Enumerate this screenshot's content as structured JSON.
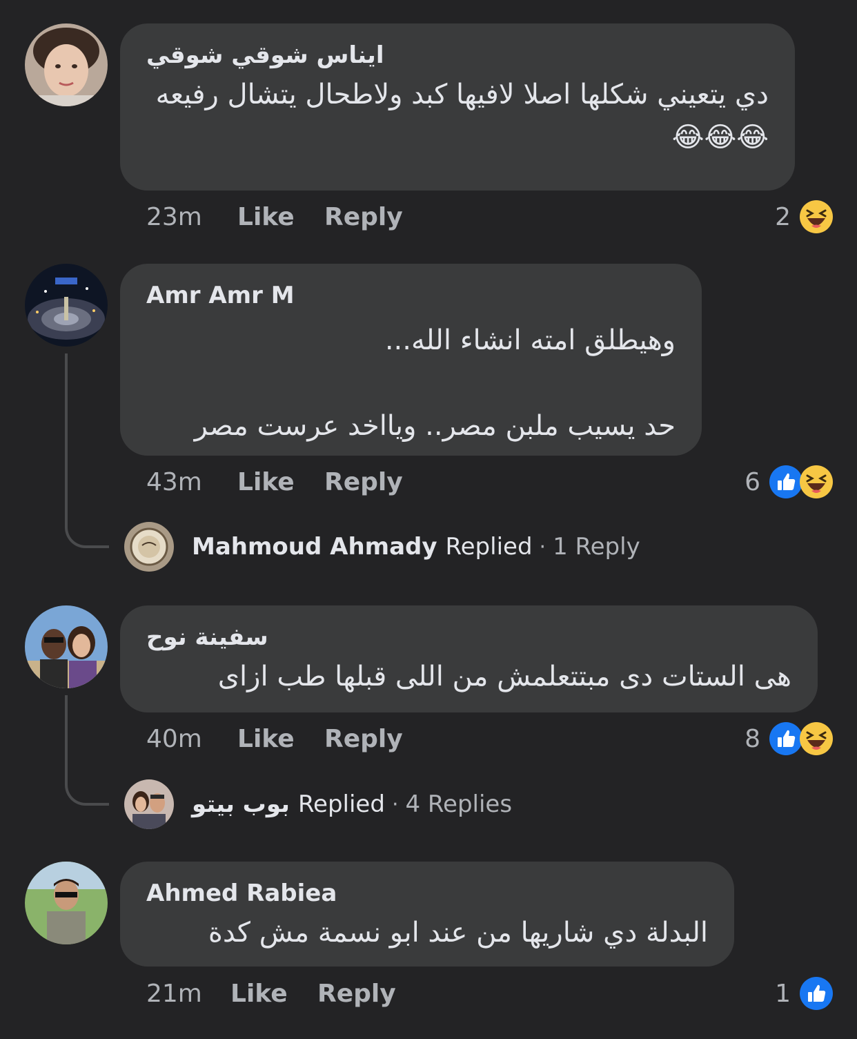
{
  "comments": [
    {
      "author": "ايناس شوقي شوقي",
      "text": "دي يتعيني شكلها اصلا لافيها كبد ولاطحال يتشال رفيعه😂😂😂",
      "time": "23m",
      "like_label": "Like",
      "reply_label": "Reply",
      "reaction_count": "2",
      "reactions": [
        "haha-icon"
      ]
    },
    {
      "author": "Amr Amr M",
      "text": "وهيطلق امته انشاء الله...\n\nحد يسيب ملبن مصر.. ويااخد عرست مصر",
      "time": "43m",
      "like_label": "Like",
      "reply_label": "Reply",
      "reaction_count": "6",
      "reactions": [
        "like-icon",
        "haha-icon"
      ],
      "replied": {
        "name": "Mahmoud Ahmady",
        "word": "Replied",
        "dot": "·",
        "count": "1 Reply"
      }
    },
    {
      "author": "سفينة نوح",
      "text": "هى الستات دى مبتتعلمش من اللى قبلها طب ازاى",
      "time": "40m",
      "like_label": "Like",
      "reply_label": "Reply",
      "reaction_count": "8",
      "reactions": [
        "like-icon",
        "haha-icon"
      ],
      "replied": {
        "name": "بوب بيتو",
        "word": "Replied",
        "dot": "·",
        "count": "4 Replies"
      }
    },
    {
      "author": "Ahmed Rabiea",
      "text": "البدلة دي شاريها من عند ابو نسمة مش كدة",
      "time": "21m",
      "like_label": "Like",
      "reply_label": "Reply",
      "reaction_count": "1",
      "reactions": [
        "like-icon"
      ]
    }
  ],
  "colors": {
    "background": "#232325",
    "bubble": "#3a3b3c",
    "primary_text": "#e4e6eb",
    "secondary_text": "#b0b3b8",
    "like_blue": "#1877f2",
    "haha_yellow": "#f7c744"
  }
}
